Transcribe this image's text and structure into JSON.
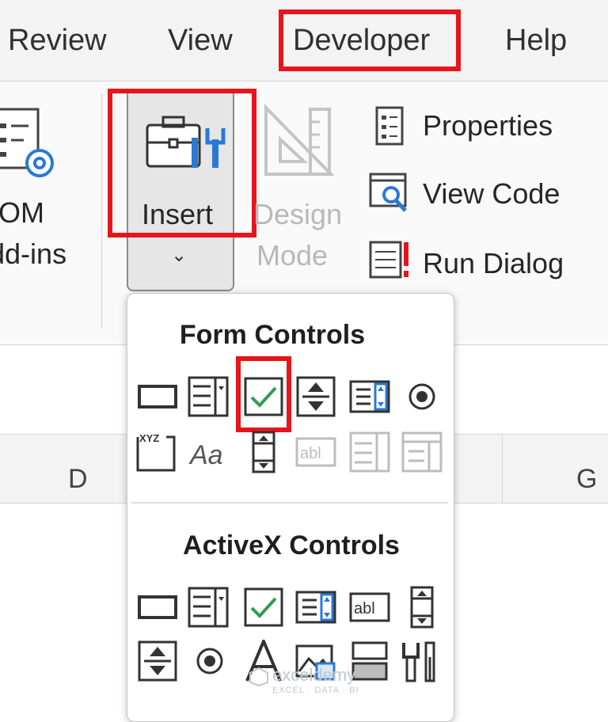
{
  "tabs": [
    "Review",
    "View",
    "Developer",
    "Help"
  ],
  "ribbon": {
    "com_addins_line1": "COM",
    "com_addins_line2": "Add-ins",
    "insert_label": "Insert",
    "design_mode_line1": "Design",
    "design_mode_line2": "Mode",
    "properties_label": "Properties",
    "view_code_label": "View Code",
    "run_dialog_label": "Run Dialog"
  },
  "columns": [
    "D",
    "G"
  ],
  "dropdown": {
    "form_controls_title": "Form Controls",
    "activex_controls_title": "ActiveX Controls",
    "form_controls": [
      "button-icon",
      "combo-box-icon",
      "check-box-icon",
      "spin-button-icon",
      "list-box-icon",
      "option-button-icon",
      "group-box-icon",
      "label-icon",
      "scroll-bar-icon",
      "text-field-icon",
      "combo-list-edit-icon",
      "combo-drop-down-edit-icon"
    ],
    "activex_controls": [
      "command-button-icon",
      "combo-box-icon",
      "check-box-icon",
      "list-box-icon",
      "text-box-icon",
      "scroll-bar-icon",
      "spin-button-icon",
      "option-button-icon",
      "label-icon",
      "image-icon",
      "toggle-button-icon",
      "more-controls-icon"
    ]
  },
  "watermark": {
    "name": "exceldemy",
    "tagline": "EXCEL · DATA · BI"
  },
  "colors": {
    "highlight": "#e8141c",
    "check": "#2e9e4f",
    "accent_blue": "#2b78d4"
  }
}
